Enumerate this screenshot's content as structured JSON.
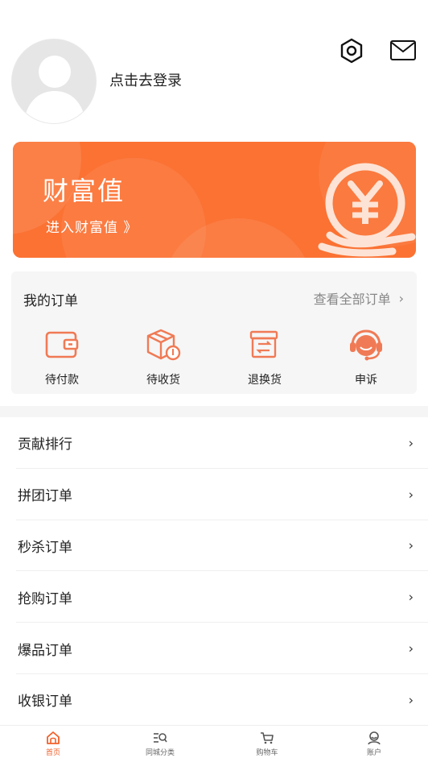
{
  "profile": {
    "login_text": "点击去登录"
  },
  "wealth": {
    "title": "财富值",
    "link": "进入财富值 》"
  },
  "orders": {
    "title": "我的订单",
    "view_all": "查看全部订单",
    "items": [
      {
        "label": "待付款",
        "icon": "wallet-icon"
      },
      {
        "label": "待收货",
        "icon": "package-icon"
      },
      {
        "label": "退换货",
        "icon": "exchange-box-icon"
      },
      {
        "label": "申诉",
        "icon": "headset-icon"
      }
    ]
  },
  "menu": [
    {
      "label": "贡献排行"
    },
    {
      "label": "拼团订单"
    },
    {
      "label": "秒杀订单"
    },
    {
      "label": "抢购订单"
    },
    {
      "label": "爆品订单"
    },
    {
      "label": "收银订单"
    }
  ],
  "tabs": [
    {
      "label": "首页",
      "icon": "home-icon",
      "active": true
    },
    {
      "label": "同城分类",
      "icon": "category-icon",
      "active": false
    },
    {
      "label": "购物车",
      "icon": "cart-icon",
      "active": false
    },
    {
      "label": "账户",
      "icon": "account-icon",
      "active": false
    }
  ],
  "colors": {
    "accent": "#f2602a",
    "card": "#fb7233",
    "icon_orange": "#f07a55"
  }
}
